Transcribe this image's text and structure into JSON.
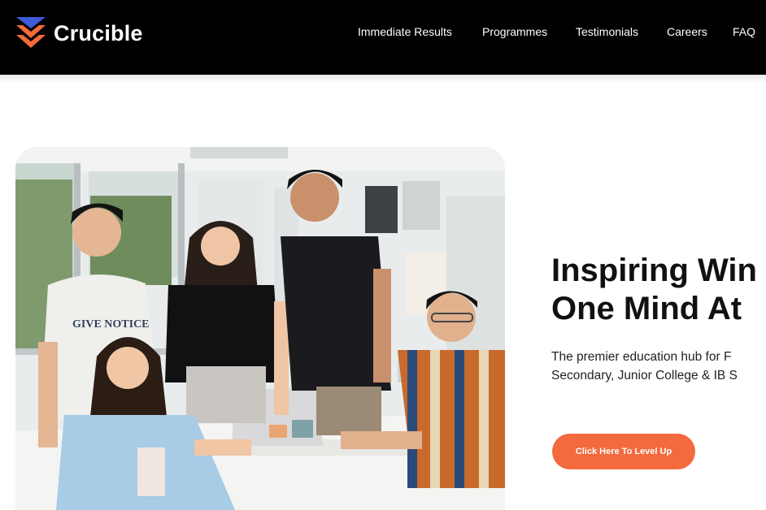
{
  "brand": {
    "name": "Crucible",
    "colors": {
      "chevron_top": "#3f5bd6",
      "chevron_bottom": "#f26a3d",
      "accent": "#f26a3d"
    }
  },
  "nav": {
    "items": [
      {
        "label": "Immediate Results"
      },
      {
        "label": "Programmes"
      },
      {
        "label": "Testimonials"
      },
      {
        "label": "Careers"
      },
      {
        "label": "FAQ"
      }
    ]
  },
  "hero": {
    "title_line1": "Inspiring Win",
    "title_line2": "One Mind At",
    "subtitle_line1": "The premier education hub for F",
    "subtitle_line2": "Secondary, Junior College & IB S",
    "cta_label": "Click Here To Level Up",
    "photo": {
      "shirt_text_line1": "GIVE NOTICE"
    }
  }
}
